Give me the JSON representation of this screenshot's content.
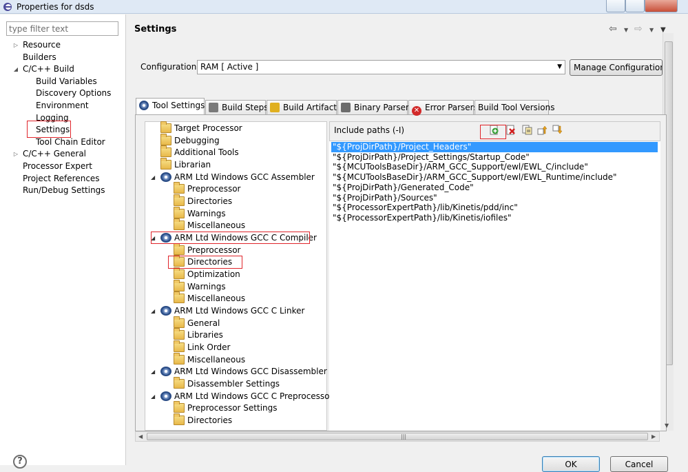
{
  "window": {
    "title": "Properties for dsds"
  },
  "filter": {
    "placeholder": "type filter text"
  },
  "nav": [
    {
      "label": "Resource",
      "indent": 0,
      "twisty": "collapsed"
    },
    {
      "label": "Builders",
      "indent": 0,
      "twisty": ""
    },
    {
      "label": "C/C++ Build",
      "indent": 0,
      "twisty": "expanded"
    },
    {
      "label": "Build Variables",
      "indent": 1,
      "twisty": ""
    },
    {
      "label": "Discovery Options",
      "indent": 1,
      "twisty": ""
    },
    {
      "label": "Environment",
      "indent": 1,
      "twisty": ""
    },
    {
      "label": "Logging",
      "indent": 1,
      "twisty": ""
    },
    {
      "label": "Settings",
      "indent": 1,
      "twisty": "",
      "selected": true
    },
    {
      "label": "Tool Chain Editor",
      "indent": 1,
      "twisty": ""
    },
    {
      "label": "C/C++ General",
      "indent": 0,
      "twisty": "collapsed"
    },
    {
      "label": "Processor Expert",
      "indent": 0,
      "twisty": ""
    },
    {
      "label": "Project References",
      "indent": 0,
      "twisty": ""
    },
    {
      "label": "Run/Debug Settings",
      "indent": 0,
      "twisty": ""
    }
  ],
  "page": {
    "title": "Settings"
  },
  "config": {
    "label": "Configuration:",
    "value": "RAM  [ Active ]",
    "manage_label": "Manage Configurations..."
  },
  "tabs": [
    {
      "label": "Tool Settings",
      "icon": "gear-icon",
      "active": true
    },
    {
      "label": "Build Steps",
      "icon": "hammer-icon"
    },
    {
      "label": "Build Artifact",
      "icon": "trophy-icon"
    },
    {
      "label": "Binary Parsers",
      "icon": "binary-icon"
    },
    {
      "label": "Error Parsers",
      "icon": "error-icon"
    },
    {
      "label": "Build Tool Versions",
      "icon": ""
    }
  ],
  "tool_tree": [
    {
      "label": "Target Processor",
      "level": 0,
      "icon": "folder"
    },
    {
      "label": "Debugging",
      "level": 0,
      "icon": "folder"
    },
    {
      "label": "Additional Tools",
      "level": 0,
      "icon": "folder"
    },
    {
      "label": "Librarian",
      "level": 0,
      "icon": "folder"
    },
    {
      "label": "ARM Ltd Windows GCC Assembler",
      "level": 0,
      "icon": "gear",
      "expanded": true
    },
    {
      "label": "Preprocessor",
      "level": 1,
      "icon": "folder"
    },
    {
      "label": "Directories",
      "level": 1,
      "icon": "folder"
    },
    {
      "label": "Warnings",
      "level": 1,
      "icon": "folder"
    },
    {
      "label": "Miscellaneous",
      "level": 1,
      "icon": "folder"
    },
    {
      "label": "ARM Ltd Windows GCC C Compiler",
      "level": 0,
      "icon": "gear",
      "expanded": true
    },
    {
      "label": "Preprocessor",
      "level": 1,
      "icon": "folder"
    },
    {
      "label": "Directories",
      "level": 1,
      "icon": "folder",
      "selected": true
    },
    {
      "label": "Optimization",
      "level": 1,
      "icon": "folder"
    },
    {
      "label": "Warnings",
      "level": 1,
      "icon": "folder"
    },
    {
      "label": "Miscellaneous",
      "level": 1,
      "icon": "folder"
    },
    {
      "label": "ARM Ltd Windows GCC C Linker",
      "level": 0,
      "icon": "gear",
      "expanded": true
    },
    {
      "label": "General",
      "level": 1,
      "icon": "folder"
    },
    {
      "label": "Libraries",
      "level": 1,
      "icon": "folder"
    },
    {
      "label": "Link Order",
      "level": 1,
      "icon": "folder"
    },
    {
      "label": "Miscellaneous",
      "level": 1,
      "icon": "folder"
    },
    {
      "label": "ARM Ltd Windows GCC Disassembler",
      "level": 0,
      "icon": "gear",
      "expanded": true
    },
    {
      "label": "Disassembler Settings",
      "level": 1,
      "icon": "folder"
    },
    {
      "label": "ARM Ltd Windows GCC C Preprocessor",
      "level": 0,
      "icon": "gear",
      "expanded": true
    },
    {
      "label": "Preprocessor Settings",
      "level": 1,
      "icon": "folder"
    },
    {
      "label": "Directories",
      "level": 1,
      "icon": "folder"
    }
  ],
  "include": {
    "label": "Include paths (-I)",
    "paths": [
      "\"${ProjDirPath}/Project_Headers\"",
      "\"${ProjDirPath}/Project_Settings/Startup_Code\"",
      "\"${MCUToolsBaseDir}/ARM_GCC_Support/ewl/EWL_C/include\"",
      "\"${MCUToolsBaseDir}/ARM_GCC_Support/ewl/EWL_Runtime/include\"",
      "\"${ProjDirPath}/Generated_Code\"",
      "\"${ProjDirPath}/Sources\"",
      "\"${ProcessorExpertPath}/lib/Kinetis/pdd/inc\"",
      "\"${ProcessorExpertPath}/lib/Kinetis/iofiles\""
    ],
    "toolbar": [
      "add-path-icon",
      "delete-path-icon",
      "edit-path-icon",
      "move-up-icon",
      "move-down-icon"
    ]
  },
  "buttons": {
    "ok": "OK",
    "cancel": "Cancel"
  },
  "colors": {
    "selection": "#3399ff",
    "highlight_box": "#e0242a"
  }
}
